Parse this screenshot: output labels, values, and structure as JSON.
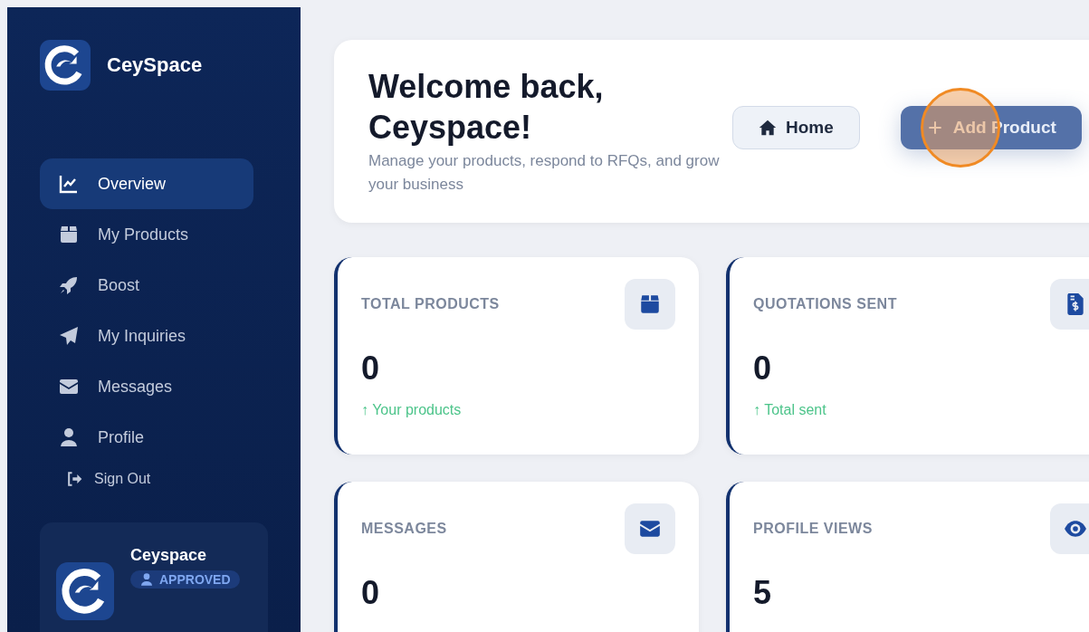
{
  "brand": {
    "name": "CeySpace"
  },
  "nav": [
    {
      "label": "Overview",
      "selected": true
    },
    {
      "label": "My Products",
      "selected": false
    },
    {
      "label": "Boost",
      "selected": false
    },
    {
      "label": "My Inquiries",
      "selected": false
    },
    {
      "label": "Messages",
      "selected": false
    },
    {
      "label": "Profile",
      "selected": false
    }
  ],
  "sign_out": "Sign Out",
  "user": {
    "name": "Ceyspace",
    "badge": "APPROVED"
  },
  "header": {
    "title": "Welcome back, Ceyspace!",
    "subtitle": "Manage your products, respond to RFQs, and grow your business",
    "buttons": [
      {
        "label": "Home",
        "kind": "secondary"
      },
      {
        "label": "Add Product",
        "kind": "primary"
      }
    ]
  },
  "stats": [
    {
      "label": "TOTAL PRODUCTS",
      "value": "0",
      "trend": "↑ Your products"
    },
    {
      "label": "QUOTATIONS SENT",
      "value": "0",
      "trend": "↑ Total sent"
    },
    {
      "label": "MESSAGES",
      "value": "0"
    },
    {
      "label": "PROFILE VIEWS",
      "value": "5"
    }
  ]
}
